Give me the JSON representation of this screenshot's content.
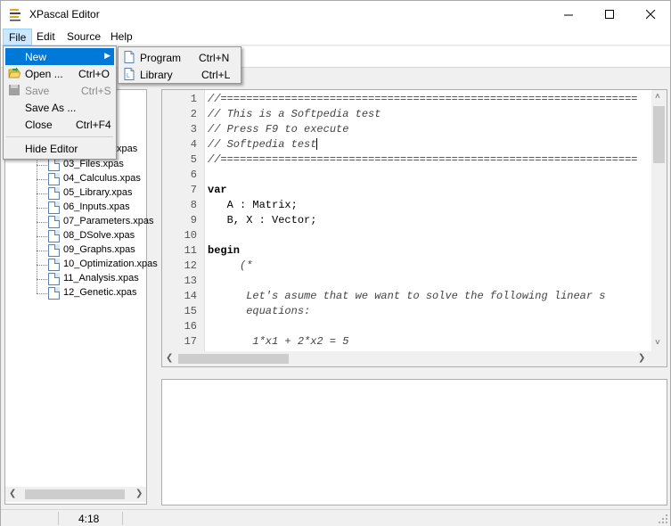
{
  "window": {
    "title": "XPascal Editor"
  },
  "menubar": {
    "file": "File",
    "edit": "Edit",
    "source": "Source",
    "help": "Help"
  },
  "file_menu": {
    "new": {
      "label": "New"
    },
    "open": {
      "label": "Open ...",
      "shortcut": "Ctrl+O"
    },
    "save": {
      "label": "Save",
      "shortcut": "Ctrl+S"
    },
    "save_as": {
      "label": "Save As ..."
    },
    "close": {
      "label": "Close",
      "shortcut": "Ctrl+F4"
    },
    "hide_editor": {
      "label": "Hide Editor"
    }
  },
  "new_submenu": {
    "program": {
      "label": "Program",
      "shortcut": "Ctrl+N"
    },
    "library": {
      "label": "Library",
      "shortcut": "Ctrl+L"
    }
  },
  "tree": {
    "items": [
      "03_Files.xpas",
      "04_Calculus.xpas",
      "05_Library.xpas",
      "06_Inputs.xpas",
      "07_Parameters.xpas",
      "08_DSolve.xpas",
      "09_Graphs.xpas",
      "10_Optimization.xpas",
      "11_Analysis.xpas",
      "12_Genetic.xpas"
    ],
    "partial_item": "xpas"
  },
  "editor": {
    "line_numbers": [
      "1",
      "2",
      "3",
      "4",
      "5",
      "6",
      "7",
      "8",
      "9",
      "10",
      "11",
      "12",
      "13",
      "14",
      "15",
      "16",
      "17"
    ],
    "lines": [
      "//=================================================================",
      "// This is a Softpedia test",
      "// Press F9 to execute",
      "// Softpedia test",
      "//=================================================================",
      "",
      "var",
      "   A : Matrix;",
      "   B, X : Vector;",
      "",
      "begin",
      "     (*",
      "",
      "      Let's asume that we want to solve the following linear s",
      "      equations:",
      "",
      "       1*x1 + 2*x2 = 5"
    ]
  },
  "statusbar": {
    "position": "4:18"
  },
  "colors": {
    "menu_highlight": "#0078d7",
    "menu_active": "#cce8ff"
  }
}
